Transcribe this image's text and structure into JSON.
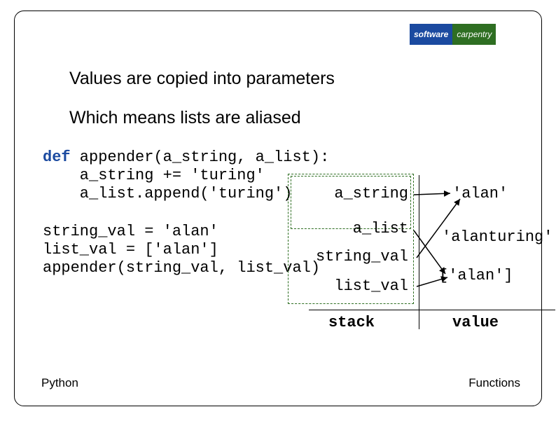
{
  "logo": {
    "left": "software",
    "right": "carpentry"
  },
  "bullets": {
    "b1": "Values are copied into parameters",
    "b2": "Which means lists are aliased"
  },
  "code": {
    "kw_def": "def",
    "line1_rest": " appender(a_string, a_list):",
    "line2": "    a_string += 'turing'",
    "line3": "    a_list.append('turing')",
    "line4": "string_val = 'alan'",
    "line5": "list_val = ['alan']",
    "line6": "appender(string_val, list_val)"
  },
  "stack": {
    "a_string": "a_string",
    "a_list": "a_list",
    "string_val": "string_val",
    "list_val": "list_val",
    "header_stack": "stack",
    "header_value": "value"
  },
  "values": {
    "alan": "'alan'",
    "alanturing": "'alanturing'",
    "list_alan": "['alan']"
  },
  "footer": {
    "left": "Python",
    "right": "Functions"
  }
}
